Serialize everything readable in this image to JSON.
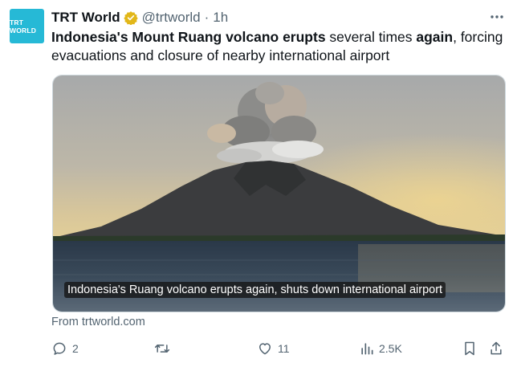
{
  "account": {
    "avatar_text": "TRT WORLD",
    "name": "TRT World",
    "handle": "@trtworld",
    "separator": "·",
    "time": "1h",
    "verified": true
  },
  "tweet": {
    "part1": "Indonesia's Mount Ruang volcano erupts",
    "part2": " several times ",
    "part3": "again",
    "part4": ", forcing evacuations and closure of nearby international airport"
  },
  "media": {
    "caption": "Indonesia's Ruang volcano erupts again, shuts down international airport"
  },
  "source": "From trtworld.com",
  "actions": {
    "replies": "2",
    "retweets": "",
    "likes": "11",
    "views": "2.5K"
  },
  "colors": {
    "brand_teal": "#26b9d6",
    "verified_gold": "#e2b719",
    "text_primary": "#0f1419",
    "text_secondary": "#536471"
  }
}
